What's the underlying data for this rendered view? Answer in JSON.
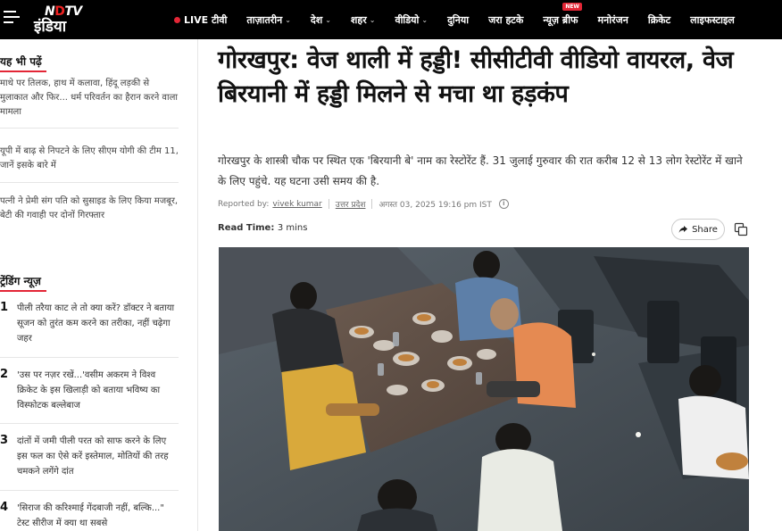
{
  "logo": {
    "top": "NDTV",
    "bottom": "इंडिया"
  },
  "nav": {
    "items": [
      {
        "label": "LIVE टीवी",
        "chevron": false,
        "live": true
      },
      {
        "label": "ताज़ातरीन",
        "chevron": true
      },
      {
        "label": "देश",
        "chevron": true
      },
      {
        "label": "शहर",
        "chevron": true
      },
      {
        "label": "वीडियो",
        "chevron": true
      },
      {
        "label": "दुनिया",
        "chevron": false
      },
      {
        "label": "जरा हटके",
        "chevron": false
      },
      {
        "label": "न्यूज़ ब्रीफ",
        "chevron": false,
        "badge": "NEW"
      },
      {
        "label": "मनोरंजन",
        "chevron": false
      },
      {
        "label": "क्रिकेट",
        "chevron": false
      },
      {
        "label": "लाइफस्टाइल",
        "chevron": false
      }
    ]
  },
  "sidebar": {
    "also_read_heading": "यह भी पढ़ें",
    "also_read": [
      "माथे पर तिलक, हाथ में कलावा, हिंदू लड़की से मुलाकात और फिर... धर्म परिवर्तन का हैरान करने वाला मामला",
      "यूपी में बाढ़ से निपटने के लिए सीएम योगी की टीम 11, जानें इसके बारे में",
      "पत्नी ने प्रेमी संग पति को सुसाइड के लिए किया मजबूर, बेटी की गवाही पर दोनों गिरफ्तार"
    ],
    "trending_heading": "ट्रेंडिंग न्यूज़",
    "trending": [
      {
        "num": "1",
        "text": "पीली तरैया काट ले तो क्या करें? डॉक्टर ने बताया सूजन को तुरंत कम करने का तरीका, नहीं चढ़ेगा जहर"
      },
      {
        "num": "2",
        "text": "'उस पर नज़र रखें...'वसीम अकरम ने विश्व क्रिकेट के इस खिलाड़ी को बताया भविष्य का विस्फोटक बल्लेबाज"
      },
      {
        "num": "3",
        "text": "दांतों में जमी पीली परत को साफ करने के लिए इस फल का ऐसे करें इस्तेमाल, मोतियों की तरह चमकने लगेंगे दांत"
      },
      {
        "num": "4",
        "text": "'सिराज की करिश्माई गेंदबाजी नहीं, बल्कि...\" टेस्ट सीरीज में क्या था सबसे"
      }
    ]
  },
  "article": {
    "headline": "गोरखपुर: वेज थाली में हड्डी! सीसीटीवी वीडियो वायरल, वेज बिरयानी में हड्डी मिलने से मचा था हड़कंप",
    "summary": "गोरखपुर के शास्त्री चौक पर स्थित एक 'बिरयानी बे' नाम का रेस्टोरेंट हैं. 31 जुलाई गुरुवार की रात करीब 12 से 13 लोग रेस्टोरेंट में खाने के लिए पहुंचे. यह घटना उसी समय की है.",
    "reported_by_label": "Reported by:",
    "author": "vivek kumar",
    "category": "उत्तर प्रदेश",
    "date": "अगस्त 03, 2025 19:16 pm IST",
    "read_time_label": "Read Time:",
    "read_time": "3 mins",
    "share_label": "Share"
  },
  "icons": {
    "menu": "menu-icon",
    "share": "share-arrow-icon",
    "copy": "copy-icon",
    "info": "info-icon"
  },
  "colors": {
    "nav_bg": "#000000",
    "accent": "#e32636"
  }
}
